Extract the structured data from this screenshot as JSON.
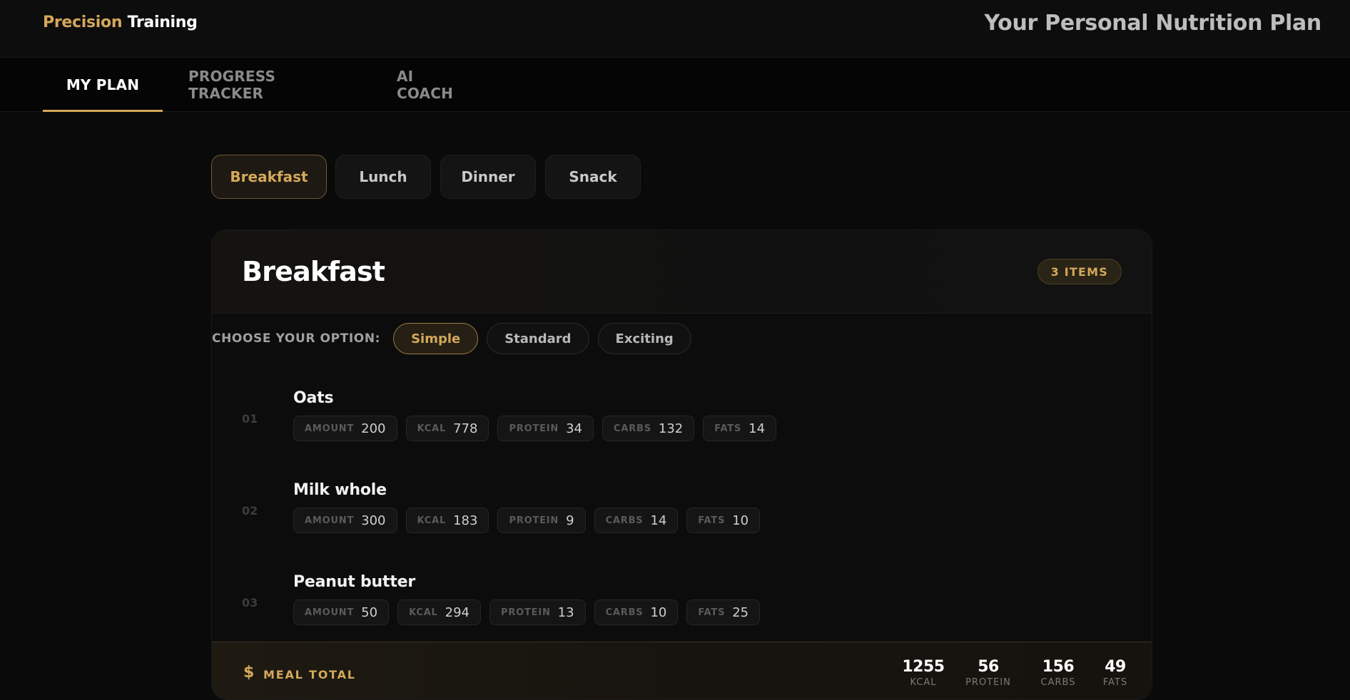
{
  "header": {
    "brand_accent": "Precision",
    "brand_rest": "Training",
    "title": "Your Personal Nutrition Plan"
  },
  "nav": {
    "tabs": [
      {
        "label": "MY PLAN",
        "active": true
      },
      {
        "label": "PROGRESS TRACKER",
        "active": false
      },
      {
        "label": "AI COACH",
        "active": false
      }
    ]
  },
  "meal_tabs": [
    {
      "label": "Breakfast",
      "active": true
    },
    {
      "label": "Lunch",
      "active": false
    },
    {
      "label": "Dinner",
      "active": false
    },
    {
      "label": "Snack",
      "active": false
    }
  ],
  "meal": {
    "title": "Breakfast",
    "items_badge": "3 ITEMS",
    "option_label": "CHOOSE YOUR OPTION:",
    "options": [
      {
        "label": "Simple",
        "active": true
      },
      {
        "label": "Standard",
        "active": false
      },
      {
        "label": "Exciting",
        "active": false
      }
    ],
    "foods": [
      {
        "index": "01",
        "name": "Oats",
        "stats": [
          {
            "k": "AMOUNT",
            "v": "200"
          },
          {
            "k": "KCAL",
            "v": "778"
          },
          {
            "k": "PROTEIN",
            "v": "34"
          },
          {
            "k": "CARBS",
            "v": "132"
          },
          {
            "k": "FATS",
            "v": "14"
          }
        ]
      },
      {
        "index": "02",
        "name": "Milk whole",
        "stats": [
          {
            "k": "AMOUNT",
            "v": "300"
          },
          {
            "k": "KCAL",
            "v": "183"
          },
          {
            "k": "PROTEIN",
            "v": "9"
          },
          {
            "k": "CARBS",
            "v": "14"
          },
          {
            "k": "FATS",
            "v": "10"
          }
        ]
      },
      {
        "index": "03",
        "name": "Peanut butter",
        "stats": [
          {
            "k": "AMOUNT",
            "v": "50"
          },
          {
            "k": "KCAL",
            "v": "294"
          },
          {
            "k": "PROTEIN",
            "v": "13"
          },
          {
            "k": "CARBS",
            "v": "10"
          },
          {
            "k": "FATS",
            "v": "25"
          }
        ]
      }
    ],
    "total": {
      "icon": "dollar-icon",
      "icon_glyph": "$",
      "label": "MEAL TOTAL",
      "stats": [
        {
          "num": "1255",
          "lbl": "KCAL"
        },
        {
          "num": "56",
          "lbl": "PROTEIN"
        },
        {
          "num": "156",
          "lbl": "CARBS"
        },
        {
          "num": "49",
          "lbl": "FATS"
        }
      ]
    }
  },
  "colors": {
    "accent": "#d4a85a",
    "background": "#0a0a0a",
    "card": "#0c0c0c"
  }
}
